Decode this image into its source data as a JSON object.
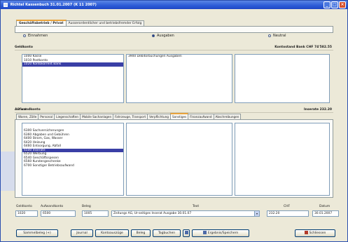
{
  "window": {
    "title": "Richtel Kassenbuch 31.01.2007 (K 11 2007)",
    "controls": [
      "_",
      "□",
      "×"
    ]
  },
  "tabs": [
    {
      "label": "Geschäftsbetrieb / Privat",
      "active": true
    },
    {
      "label": "Ausserordentlicher und betriebsfremder Erfolg",
      "active": false
    }
  ],
  "direction": {
    "options": [
      "Einnahmen",
      "Ausgaben",
      "Neutral"
    ],
    "selected": "Ausgaben"
  },
  "gegenkonto": {
    "header": "Geldkonto",
    "balance": "Kontostand Bank CHF 74'582.55",
    "list1": [
      "1000 Kasse",
      "1010 Postkonto",
      "1020 Kontokorrent Bank"
    ],
    "list1_selected": 2,
    "list2": [
      "3900 Debitorbuchungen Ausgaben"
    ],
    "list3": []
  },
  "aufwandkonto": {
    "header": "Aufwandkonto",
    "right_label": "Inserate 232.20",
    "privat_label": "Privat",
    "subtabs": [
      {
        "label": "Waren, Zölle",
        "active": false
      },
      {
        "label": "Personal",
        "active": false
      },
      {
        "label": "Liegenschaften",
        "active": false
      },
      {
        "label": "Mobile Sachanlagen",
        "active": false
      },
      {
        "label": "Fahrzeuge, Transport",
        "active": false
      },
      {
        "label": "Verpflichtung",
        "active": false
      },
      {
        "label": "Sonstiges",
        "active": true
      },
      {
        "label": "Finanzaufwand",
        "active": false
      },
      {
        "label": "Abschreibungen",
        "active": false
      }
    ],
    "list": [
      "6300 Sachversicherungen",
      "6360 Abgaben und Gebühren",
      "6400 Strom, Gas, Wasser",
      "6420 Heizung",
      "6460 Entsorgung, Abfall",
      "6500 Inserate",
      "6520 Werbung",
      "6540 Geschäftsspesen",
      "6560 Kundengeschenke",
      "6700 Sonstiger Betriebsaufwand"
    ],
    "list_selected": 5
  },
  "entry": {
    "headers": [
      "Geldkonto",
      "Aufwandkonto",
      "Beleg",
      "Text",
      "CHF",
      "Datum"
    ],
    "values": {
      "geldkonto": "1020",
      "aufwandkonto": "6500",
      "beleg": "1005",
      "text": "Zeitungs AG, Ur-seitiges Inserat Ausgabe 30.01.07",
      "chf": "232.20",
      "datum": "30.01.2007"
    }
  },
  "buttons": [
    "Sammelbeleg (+)",
    "Journal",
    "Kontoauszüge",
    "Beleg",
    "Tagbuchen",
    "Ergebnis/Speichern",
    "Schliessen"
  ]
}
